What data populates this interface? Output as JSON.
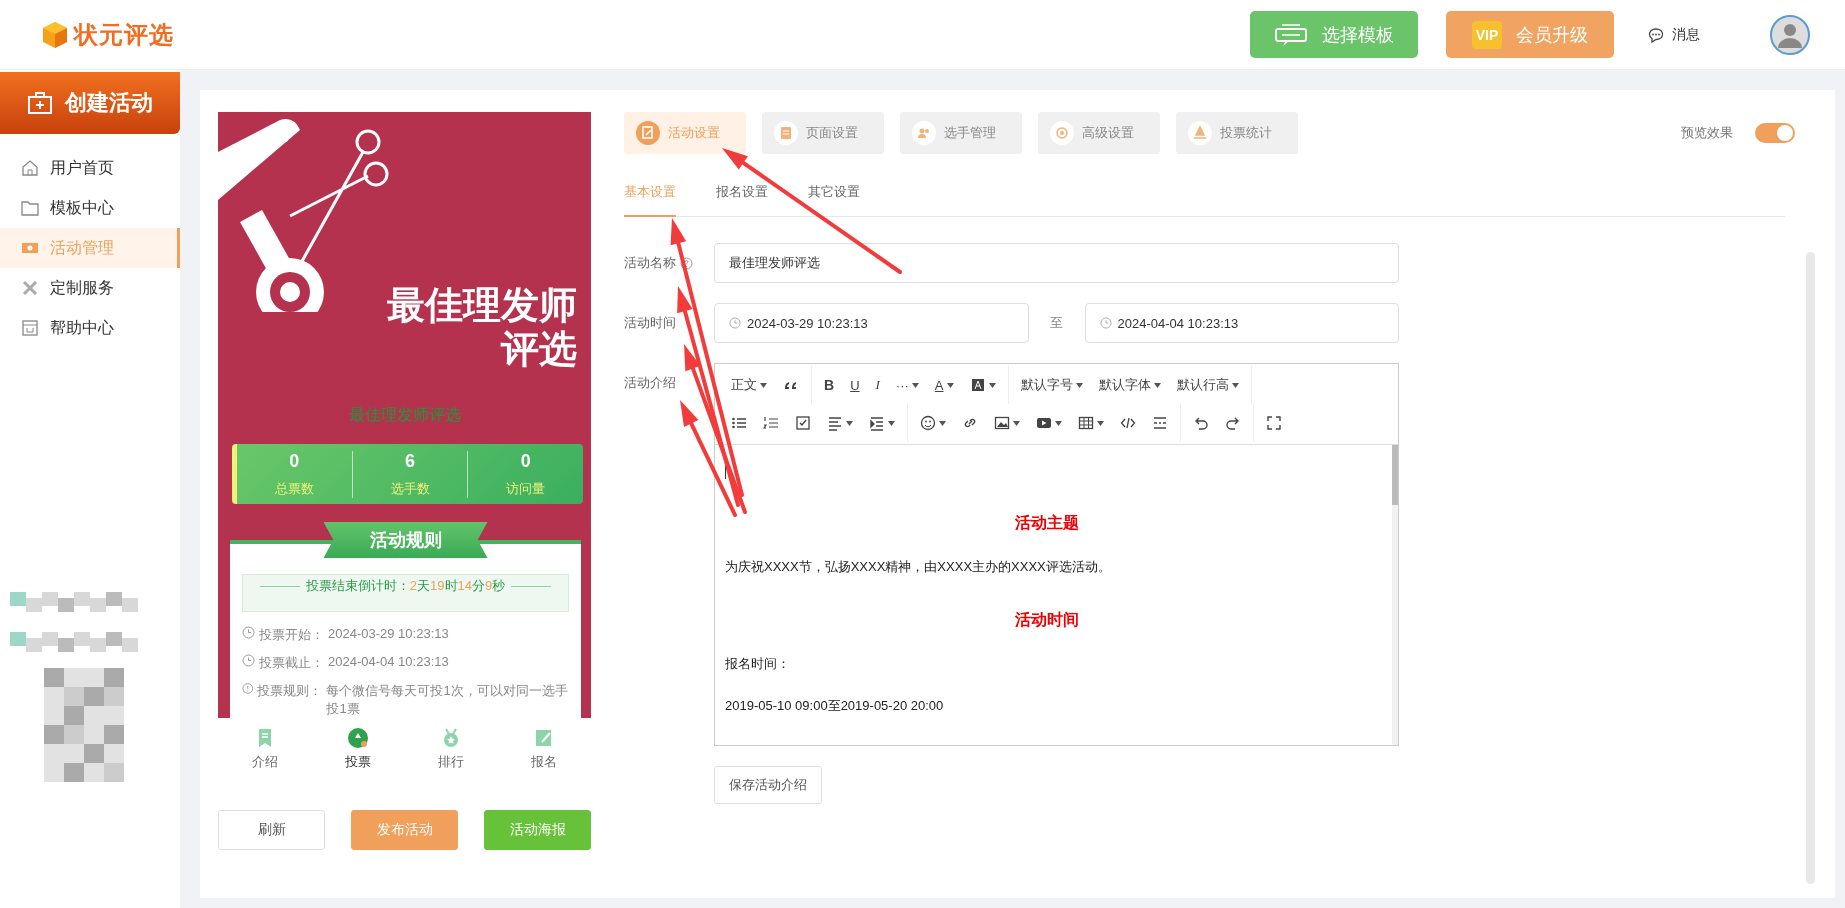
{
  "header": {
    "logo_text": "状元评选",
    "template_button": "选择模板",
    "vip_badge": "VIP",
    "vip_button": "会员升级",
    "messages": "消息"
  },
  "sidebar": {
    "create_button": "创建活动",
    "items": [
      {
        "label": "用户首页",
        "selected": false
      },
      {
        "label": "模板中心",
        "selected": false
      },
      {
        "label": "活动管理",
        "selected": true
      },
      {
        "label": "定制服务",
        "selected": false
      },
      {
        "label": "帮助中心",
        "selected": false
      }
    ]
  },
  "preview": {
    "title_lines": [
      "最佳理发师",
      "评选"
    ],
    "subtitle": "最佳理发师评选",
    "stats": [
      {
        "value": "0",
        "label": "总票数"
      },
      {
        "value": "6",
        "label": "选手数"
      },
      {
        "value": "0",
        "label": "访问量"
      }
    ],
    "rules_title": "活动规则",
    "countdown": {
      "label": "投票结束倒计时：",
      "parts": [
        {
          "value": "2",
          "unit": "天"
        },
        {
          "value": "19",
          "unit": "时"
        },
        {
          "value": "14",
          "unit": "分"
        },
        {
          "value": "9",
          "unit": "秒"
        }
      ]
    },
    "rules": [
      {
        "kind": "clock",
        "label": "投票开始：",
        "value": "2024-03-29 10:23:13"
      },
      {
        "kind": "clock",
        "label": "投票截止：",
        "value": "2024-04-04 10:23:13"
      },
      {
        "kind": "info",
        "label": "投票规则：",
        "value": "每个微信号每天可投1次，可以对同一选手投1票"
      }
    ],
    "nav": [
      {
        "label": "介绍",
        "selected": false
      },
      {
        "label": "投票",
        "selected": true
      },
      {
        "label": "排行",
        "selected": false
      },
      {
        "label": "报名",
        "selected": false
      }
    ]
  },
  "actions": [
    "刷新",
    "发布活动",
    "活动海报"
  ],
  "tabs": [
    {
      "label": "活动设置",
      "selected": true
    },
    {
      "label": "页面设置",
      "selected": false
    },
    {
      "label": "选手管理",
      "selected": false
    },
    {
      "label": "高级设置",
      "selected": false
    },
    {
      "label": "投票统计",
      "selected": false
    }
  ],
  "preview_toggle": {
    "label": "预览效果",
    "on": true
  },
  "subtabs": [
    {
      "label": "基本设置",
      "selected": true
    },
    {
      "label": "报名设置",
      "selected": false
    },
    {
      "label": "其它设置",
      "selected": false
    }
  ],
  "form": {
    "name_label": "活动名称",
    "name_value": "最佳理发师评选",
    "time_label": "活动时间",
    "start": "2024-03-29 10:23:13",
    "to": "至",
    "end": "2024-04-04 10:23:13",
    "intro_label": "活动介绍"
  },
  "toolbar": {
    "paragraph": "正文",
    "bold": "B",
    "underline": "U",
    "italic": "I",
    "more": "···",
    "font_color": "A",
    "font_size": "默认字号",
    "font_family": "默认字体",
    "line_height": "默认行高"
  },
  "editor": [
    {
      "kind": "heading",
      "text": "活动主题"
    },
    {
      "kind": "text",
      "text": "为庆祝XXXX节，弘扬XXXX精神，由XXXX主办的XXXX评选活动。"
    },
    {
      "kind": "heading",
      "text": "活动时间"
    },
    {
      "kind": "text",
      "text": "报名时间："
    },
    {
      "kind": "text",
      "text": "2019-05-10 09:00至2019-05-20 20:00"
    }
  ],
  "save_button": "保存活动介绍"
}
